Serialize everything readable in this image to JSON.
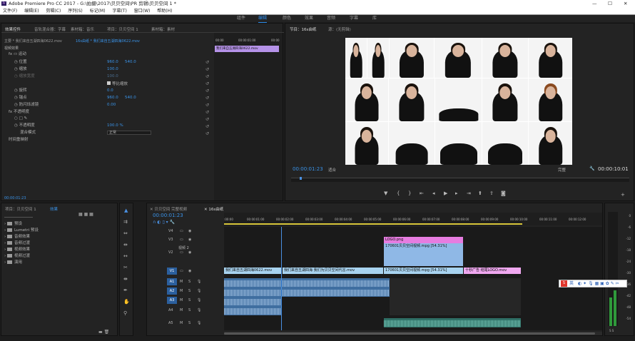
{
  "title": "Adobe Premiere Pro CC 2017 - G:\\拍摄\\2017\\贝贝空间\\PR 剪辑\\贝贝空间 1 *",
  "menu": [
    "文件(F)",
    "编辑(E)",
    "剪辑(C)",
    "序列(S)",
    "标记(M)",
    "字幕(T)",
    "窗口(W)",
    "帮助(H)"
  ],
  "workspaces": [
    "组件",
    "编辑",
    "颜色",
    "效果",
    "音频",
    "字幕",
    "库"
  ],
  "effect_controls": {
    "tabs": [
      "效果控件",
      "音轨混合器：字幕",
      "素材箱：音乐",
      "项目：贝贝空间 1",
      "素材箱：素材"
    ],
    "clip_header": "主要 * 我们来自五湖四海0622.mov",
    "seq_header": "16s由纸 * 我们来自五湖四海0622.mov",
    "section": "视频效果",
    "rows": [
      {
        "label": "运动",
        "v1": "",
        "v2": ""
      },
      {
        "label": "位置",
        "v1": "960.0",
        "v2": "540.0"
      },
      {
        "label": "缩放",
        "v1": "100.0",
        "v2": ""
      },
      {
        "label": "缩放宽度",
        "v1": "100.0",
        "v2": ""
      },
      {
        "label": "等比缩放",
        "v1": "",
        "v2": ""
      },
      {
        "label": "旋转",
        "v1": "0.0",
        "v2": ""
      },
      {
        "label": "锚点",
        "v1": "960.0",
        "v2": "540.0"
      },
      {
        "label": "防闪烁滤镜",
        "v1": "0.00",
        "v2": ""
      },
      {
        "label": "不透明度",
        "v1": "",
        "v2": ""
      },
      {
        "label": "不透明度",
        "v1": "100.0 %",
        "v2": ""
      },
      {
        "label": "混合模式",
        "v1": "正常",
        "v2": ""
      },
      {
        "label": "时间重映射",
        "v1": "",
        "v2": ""
      }
    ],
    "mini_timecodes": [
      "00:00",
      "00:00:01:00",
      "00:00"
    ],
    "mini_clip": "我们来自五湖四海0622.mov",
    "timecode": "00:00:01:23"
  },
  "program": {
    "tabs": [
      "节目：16s由纸",
      "源：(无剪辑)"
    ],
    "timecode": "00:00:01:23",
    "fit": "适合",
    "quality": "完整",
    "duration": "00:00:10:01"
  },
  "project": {
    "tabs": [
      "项目：贝贝空间 1",
      "效果"
    ],
    "items": [
      "预设",
      "Lumetri 预设",
      "音频效果",
      "音频过渡",
      "视频效果",
      "视频过渡",
      "演用"
    ]
  },
  "timeline": {
    "tab_close": "贝贝空间 完整视频",
    "tab": "16s由纸",
    "timecode": "00:00:01:23",
    "ruler": [
      ":00:00",
      "00:00:01:00",
      "00:00:02:00",
      "00:00:03:00",
      "00:00:04:00",
      "00:00:05:00",
      "00:00:06:00",
      "00:00:07:00",
      "00:00:08:00",
      "00:00:09:00",
      "00:00:10:00",
      "00:00:11:00",
      "00:00:12:00"
    ],
    "tracks": [
      "V4",
      "V3",
      "V2",
      "V1",
      "A1",
      "A2",
      "A3",
      "A4",
      "A5"
    ],
    "v2_name": "视频 2",
    "clips": {
      "logo": "LOGO.png",
      "v2": "170601贝贝空间视频.mpg [54.31%]",
      "v1a": "我们来自五湖四海0622.mov",
      "v1b": "我们来自五湖四海 我们为贝贝空间代言.mov",
      "v1c": "170601贝贝空间视频.mpg [54.31%]",
      "v1d": "十秒广告 结尾LOGO.mov"
    }
  },
  "meter": {
    "labels": [
      "0",
      "-6",
      "-12",
      "-18",
      "-24",
      "-30",
      "-36",
      "-42",
      "-48",
      "-54"
    ],
    "bottom": "S  S"
  },
  "ime": "英"
}
